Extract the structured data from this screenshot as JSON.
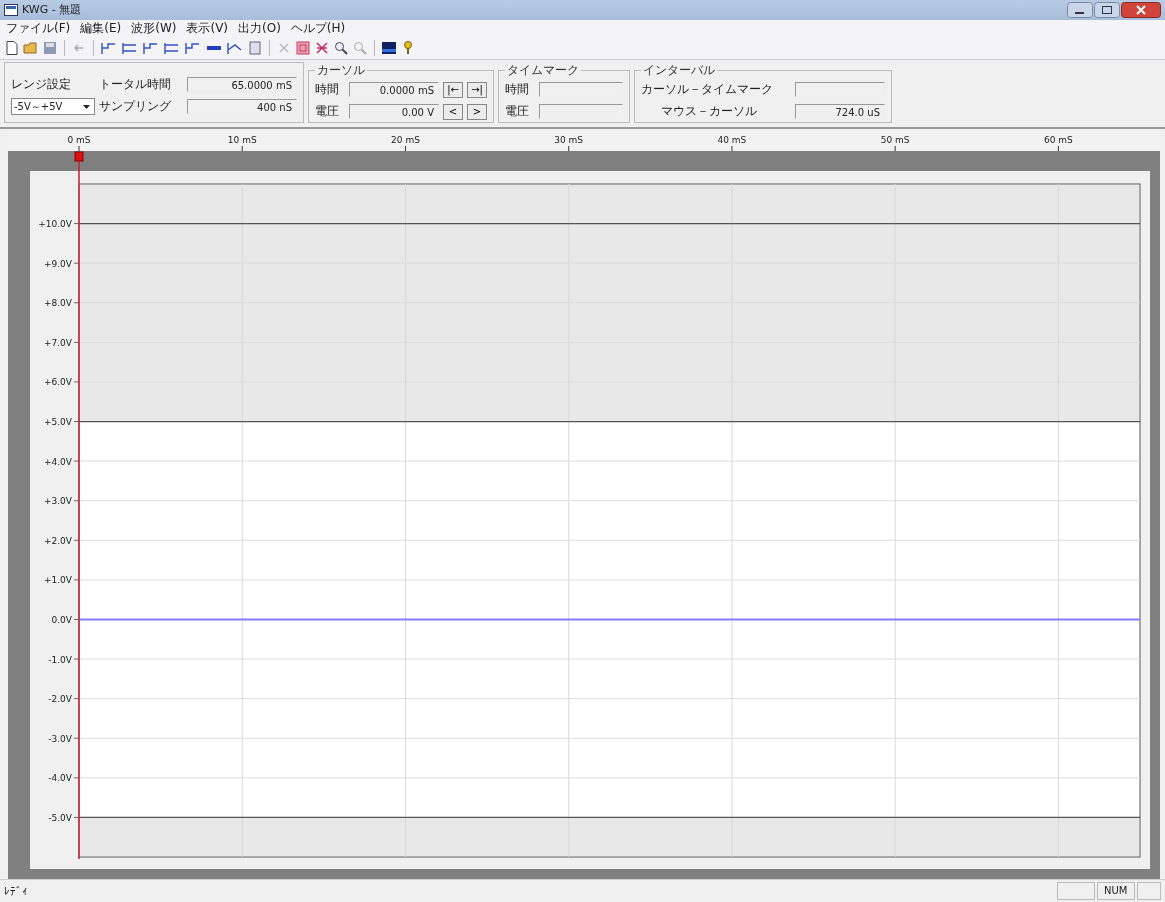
{
  "window": {
    "title": "KWG - 無題"
  },
  "menu": [
    "ファイル(F)",
    "編集(E)",
    "波形(W)",
    "表示(V)",
    "出力(O)",
    "ヘルプ(H)"
  ],
  "range_panel": {
    "range_label": "レンジ設定",
    "range_value": "-5V～+5V",
    "total_time_label": "トータル時間",
    "total_time": "65.0000 mS",
    "sampling_label": "サンプリング",
    "sampling": "400 nS"
  },
  "cursor": {
    "title": "カーソル",
    "time_label": "時間",
    "time": "0.0000 mS",
    "time_buttons": [
      "|←",
      "→|"
    ],
    "voltage_label": "電圧",
    "voltage": "0.00 V",
    "voltage_buttons": [
      "<",
      ">"
    ]
  },
  "time_mark": {
    "title": "タイムマーク",
    "time_label": "時間",
    "voltage_label": "電圧"
  },
  "interval": {
    "title": "インターバル",
    "cursor_to_mark_label": "カーソル－タイムマーク",
    "mouse_to_cursor_label": "マウス－カーソル",
    "mouse_to_cursor": "724.0 uS"
  },
  "chart_data": {
    "type": "line",
    "x": [
      0,
      65
    ],
    "xlim": [
      0,
      65
    ],
    "ylim": [
      -6,
      11
    ],
    "xticks": [
      {
        "value": 0,
        "label": "0 mS"
      },
      {
        "value": 10,
        "label": "10 mS"
      },
      {
        "value": 20,
        "label": "20 mS"
      },
      {
        "value": 30,
        "label": "30 mS"
      },
      {
        "value": 40,
        "label": "40 mS"
      },
      {
        "value": 50,
        "label": "50 mS"
      },
      {
        "value": 60,
        "label": "60 mS"
      }
    ],
    "yticks": [
      {
        "value": 10,
        "label": "+10.0V"
      },
      {
        "value": 9,
        "label": "+9.0V"
      },
      {
        "value": 8,
        "label": "+8.0V"
      },
      {
        "value": 7,
        "label": "+7.0V"
      },
      {
        "value": 6,
        "label": "+6.0V"
      },
      {
        "value": 5,
        "label": "+5.0V"
      },
      {
        "value": 4,
        "label": "+4.0V"
      },
      {
        "value": 3,
        "label": "+3.0V"
      },
      {
        "value": 2,
        "label": "+2.0V"
      },
      {
        "value": 1,
        "label": "+1.0V"
      },
      {
        "value": 0,
        "label": "0.0V"
      },
      {
        "value": -1,
        "label": "-1.0V"
      },
      {
        "value": -2,
        "label": "-2.0V"
      },
      {
        "value": -3,
        "label": "-3.0V"
      },
      {
        "value": -4,
        "label": "-4.0V"
      },
      {
        "value": -5,
        "label": "-5.0V"
      }
    ],
    "grid": true,
    "series": [
      {
        "color": "#8080ff",
        "values": [
          0,
          0
        ]
      }
    ]
  },
  "status_bar": {
    "text": "ﾚﾃﾞｨ",
    "indicators": [
      "NUM"
    ]
  }
}
